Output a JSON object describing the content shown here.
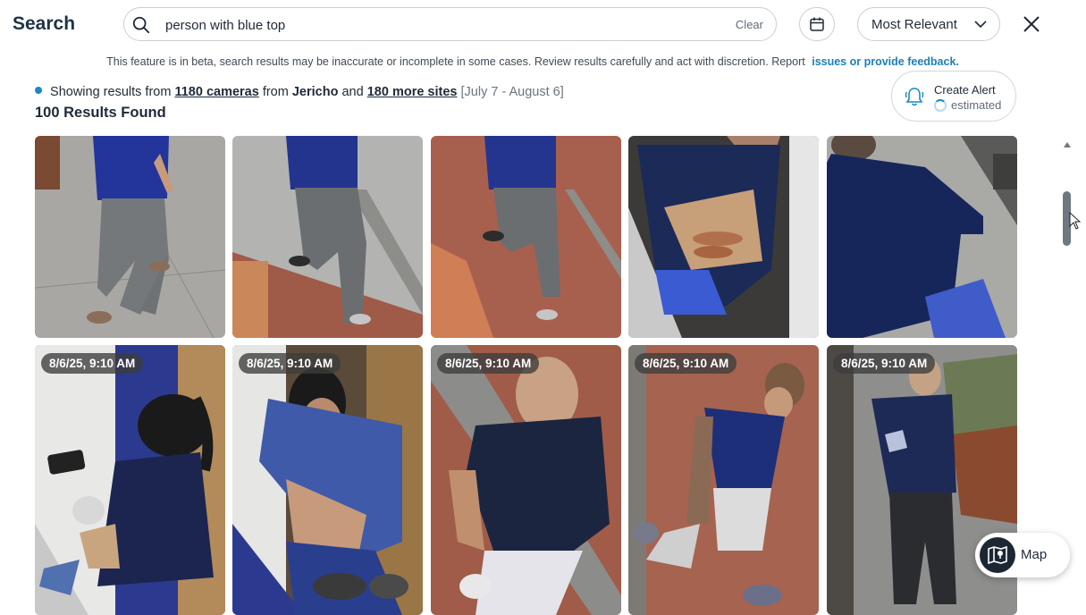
{
  "header": {
    "title": "Search",
    "search_value": "person with blue top",
    "clear_label": "Clear",
    "sort_label": "Most Relevant"
  },
  "notice": {
    "text": "This feature is in beta, search results may be inaccurate or incomplete in some cases. Review results carefully and act with discretion. Report",
    "link": "issues or provide feedback."
  },
  "summary": {
    "prefix": "Showing results from",
    "cameras": "1180 cameras",
    "from": "from",
    "site": "Jericho",
    "and": "and",
    "more_sites": "180 more sites",
    "date_range": "[July 7 - August 6]",
    "results_count": "100 Results Found"
  },
  "alert": {
    "label": "Create Alert",
    "status": "estimated"
  },
  "results": {
    "row1": [
      {
        "timestamp": ""
      },
      {
        "timestamp": ""
      },
      {
        "timestamp": ""
      },
      {
        "timestamp": ""
      },
      {
        "timestamp": ""
      }
    ],
    "row2": [
      {
        "timestamp": "8/6/25, 9:10 AM"
      },
      {
        "timestamp": "8/6/25, 9:10 AM"
      },
      {
        "timestamp": "8/6/25, 9:10 AM"
      },
      {
        "timestamp": "8/6/25, 9:10 AM"
      },
      {
        "timestamp": "8/6/25, 9:10 AM"
      }
    ]
  },
  "map": {
    "label": "Map"
  },
  "colors": {
    "accent": "#1a88c9",
    "link": "#1a7fb8",
    "navy_top": "#1e2f6b"
  }
}
